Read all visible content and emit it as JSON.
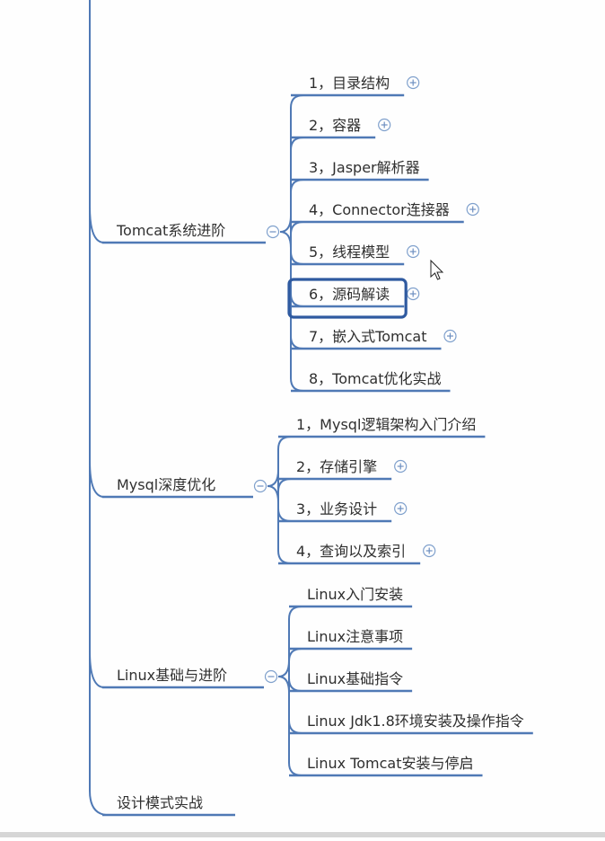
{
  "branches": [
    {
      "label": "Tomcat系统进阶",
      "children": [
        {
          "label": "1，目录结构",
          "expandable": true
        },
        {
          "label": "2，容器",
          "expandable": true
        },
        {
          "label": "3，Jasper解析器",
          "expandable": false
        },
        {
          "label": "4，Connector连接器",
          "expandable": true
        },
        {
          "label": "5，线程模型",
          "expandable": true
        },
        {
          "label": "6，源码解读",
          "expandable": true,
          "selected": true
        },
        {
          "label": "7，嵌入式Tomcat",
          "expandable": true
        },
        {
          "label": "8，Tomcat优化实战",
          "expandable": false
        }
      ]
    },
    {
      "label": "Mysql深度优化",
      "children": [
        {
          "label": "1，Mysql逻辑架构入门介绍",
          "expandable": false
        },
        {
          "label": "2，存储引擎",
          "expandable": true
        },
        {
          "label": "3，业务设计",
          "expandable": true
        },
        {
          "label": "4，查询以及索引",
          "expandable": true
        }
      ]
    },
    {
      "label": "Linux基础与进阶",
      "children": [
        {
          "label": "Linux入门安装",
          "expandable": false
        },
        {
          "label": "Linux注意事项",
          "expandable": false
        },
        {
          "label": "Linux基础指令",
          "expandable": false
        },
        {
          "label": "Linux Jdk1.8环境安装及操作指令",
          "expandable": false
        },
        {
          "label": "Linux Tomcat安装与停启",
          "expandable": false
        }
      ]
    },
    {
      "label": "设计模式实战",
      "children": []
    }
  ],
  "colors": {
    "connector": "#4f79b5",
    "highlight": "#2f5aa0",
    "toggle": "#7fa0cc"
  }
}
